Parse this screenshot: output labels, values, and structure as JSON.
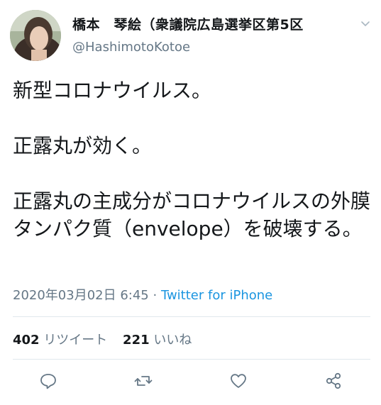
{
  "author": {
    "display_name": "橋本　琴絵（衆議院広島選挙区第5区",
    "handle": "@HashimotoKotoe"
  },
  "tweet": {
    "text": "新型コロナウイルス。\n\n正露丸が効く。\n\n正露丸の主成分がコロナウイルスの外膜タンパク質（envelope）を破壊する。",
    "timestamp": "2020年03月02日 6:45 · ",
    "source": "Twitter for iPhone"
  },
  "stats": {
    "retweets_count": "402",
    "retweets_label": "リツイート",
    "likes_count": "221",
    "likes_label": "いいね"
  },
  "icons": {
    "menu": "chevron-down-icon",
    "reply": "reply-icon",
    "retweet": "retweet-icon",
    "like": "heart-icon",
    "share": "share-icon"
  },
  "colors": {
    "text": "#14171a",
    "secondary": "#657786",
    "link": "#1b95e0",
    "divider": "#e1e8ed"
  }
}
